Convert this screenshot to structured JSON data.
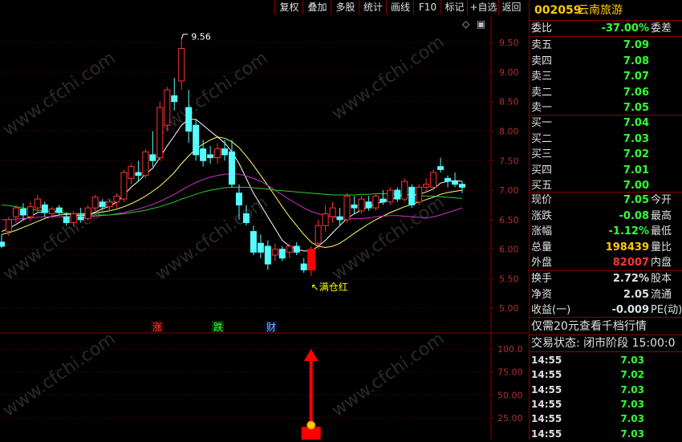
{
  "toolbar": {
    "buttons": [
      "复权",
      "叠加",
      "多股",
      "统计",
      "画线",
      "F10",
      "标记",
      "+自选",
      "返回"
    ]
  },
  "main_chart": {
    "y_axis_labels": [
      "9.50",
      "9.00",
      "8.50",
      "8.00",
      "7.50",
      "7.00",
      "6.50",
      "6.00",
      "5.50",
      "5.00"
    ],
    "high_label": "9.56",
    "signal_label": "满仓红",
    "event_markers": [
      "涨",
      "跌",
      "财"
    ],
    "diamond_icon": "◇",
    "box_icon": "▣"
  },
  "sub_chart": {
    "y_axis_labels": [
      "100.0",
      "75.00",
      "50.00",
      "25.00"
    ]
  },
  "chart_data": {
    "type": "candlestick",
    "ylim": [
      4.65,
      9.95
    ],
    "high_label_value": 9.56,
    "candles": [
      {
        "o": 6.12,
        "h": 6.25,
        "l": 6.02,
        "c": 6.05
      },
      {
        "o": 6.3,
        "h": 6.55,
        "l": 6.22,
        "c": 6.5
      },
      {
        "o": 6.55,
        "h": 6.75,
        "l": 6.45,
        "c": 6.7
      },
      {
        "o": 6.68,
        "h": 6.78,
        "l": 6.5,
        "c": 6.58
      },
      {
        "o": 6.55,
        "h": 6.8,
        "l": 6.48,
        "c": 6.72
      },
      {
        "o": 6.7,
        "h": 6.92,
        "l": 6.62,
        "c": 6.85
      },
      {
        "o": 6.75,
        "h": 6.8,
        "l": 6.55,
        "c": 6.62
      },
      {
        "o": 6.6,
        "h": 6.72,
        "l": 6.52,
        "c": 6.68
      },
      {
        "o": 6.7,
        "h": 6.75,
        "l": 6.58,
        "c": 6.62
      },
      {
        "o": 6.55,
        "h": 6.62,
        "l": 6.4,
        "c": 6.45
      },
      {
        "o": 6.45,
        "h": 6.65,
        "l": 6.38,
        "c": 6.6
      },
      {
        "o": 6.55,
        "h": 6.7,
        "l": 6.45,
        "c": 6.5
      },
      {
        "o": 6.52,
        "h": 6.75,
        "l": 6.48,
        "c": 6.7
      },
      {
        "o": 6.7,
        "h": 6.92,
        "l": 6.65,
        "c": 6.88
      },
      {
        "o": 6.8,
        "h": 6.85,
        "l": 6.68,
        "c": 6.72
      },
      {
        "o": 6.72,
        "h": 6.85,
        "l": 6.65,
        "c": 6.8
      },
      {
        "o": 6.8,
        "h": 6.95,
        "l": 6.7,
        "c": 6.9
      },
      {
        "o": 6.85,
        "h": 7.35,
        "l": 6.8,
        "c": 7.3
      },
      {
        "o": 7.2,
        "h": 7.45,
        "l": 7.1,
        "c": 7.4
      },
      {
        "o": 7.3,
        "h": 7.5,
        "l": 7.15,
        "c": 7.25
      },
      {
        "o": 7.25,
        "h": 7.7,
        "l": 7.2,
        "c": 7.65
      },
      {
        "o": 7.6,
        "h": 8.0,
        "l": 7.4,
        "c": 7.5
      },
      {
        "o": 7.55,
        "h": 8.5,
        "l": 7.5,
        "c": 8.4
      },
      {
        "o": 8.1,
        "h": 8.75,
        "l": 8.0,
        "c": 8.7
      },
      {
        "o": 8.6,
        "h": 8.9,
        "l": 8.35,
        "c": 8.5
      },
      {
        "o": 8.85,
        "h": 9.56,
        "l": 8.7,
        "c": 9.4
      },
      {
        "o": 8.4,
        "h": 8.7,
        "l": 7.8,
        "c": 8.0
      },
      {
        "o": 8.1,
        "h": 8.2,
        "l": 7.5,
        "c": 7.6
      },
      {
        "o": 7.7,
        "h": 7.85,
        "l": 7.4,
        "c": 7.5
      },
      {
        "o": 7.6,
        "h": 7.75,
        "l": 7.45,
        "c": 7.55
      },
      {
        "o": 7.55,
        "h": 7.8,
        "l": 7.45,
        "c": 7.7
      },
      {
        "o": 7.7,
        "h": 7.85,
        "l": 7.5,
        "c": 7.6
      },
      {
        "o": 7.65,
        "h": 7.85,
        "l": 7.05,
        "c": 7.1
      },
      {
        "o": 6.95,
        "h": 7.1,
        "l": 6.5,
        "c": 6.75
      },
      {
        "o": 6.6,
        "h": 6.75,
        "l": 6.4,
        "c": 6.45
      },
      {
        "o": 6.3,
        "h": 6.4,
        "l": 5.9,
        "c": 5.95
      },
      {
        "o": 6.1,
        "h": 6.25,
        "l": 5.85,
        "c": 5.95
      },
      {
        "o": 6.05,
        "h": 6.15,
        "l": 5.65,
        "c": 5.75
      },
      {
        "o": 5.9,
        "h": 6.1,
        "l": 5.8,
        "c": 6.0
      },
      {
        "o": 6.0,
        "h": 6.05,
        "l": 5.8,
        "c": 5.85
      },
      {
        "o": 5.95,
        "h": 6.1,
        "l": 5.85,
        "c": 6.05
      },
      {
        "o": 6.05,
        "h": 6.12,
        "l": 5.9,
        "c": 5.95
      },
      {
        "o": 5.75,
        "h": 5.85,
        "l": 5.6,
        "c": 5.65
      },
      {
        "o": 5.65,
        "h": 6.05,
        "l": 5.55,
        "c": 6.0
      },
      {
        "o": 6.1,
        "h": 6.5,
        "l": 6.0,
        "c": 6.4
      },
      {
        "o": 6.4,
        "h": 6.75,
        "l": 6.3,
        "c": 6.6
      },
      {
        "o": 6.55,
        "h": 6.8,
        "l": 6.45,
        "c": 6.7
      },
      {
        "o": 6.55,
        "h": 6.7,
        "l": 6.4,
        "c": 6.5
      },
      {
        "o": 6.5,
        "h": 6.95,
        "l": 6.45,
        "c": 6.9
      },
      {
        "o": 6.75,
        "h": 6.9,
        "l": 6.6,
        "c": 6.7
      },
      {
        "o": 6.65,
        "h": 6.9,
        "l": 6.6,
        "c": 6.85
      },
      {
        "o": 6.8,
        "h": 6.9,
        "l": 6.65,
        "c": 6.7
      },
      {
        "o": 6.7,
        "h": 6.95,
        "l": 6.65,
        "c": 6.9
      },
      {
        "o": 6.85,
        "h": 7.0,
        "l": 6.75,
        "c": 6.8
      },
      {
        "o": 6.8,
        "h": 7.05,
        "l": 6.75,
        "c": 7.0
      },
      {
        "o": 7.0,
        "h": 7.05,
        "l": 6.8,
        "c": 6.85
      },
      {
        "o": 6.85,
        "h": 7.2,
        "l": 6.8,
        "c": 7.15
      },
      {
        "o": 7.05,
        "h": 7.1,
        "l": 6.7,
        "c": 6.75
      },
      {
        "o": 6.8,
        "h": 7.1,
        "l": 6.75,
        "c": 7.05
      },
      {
        "o": 7.05,
        "h": 7.2,
        "l": 6.95,
        "c": 7.1
      },
      {
        "o": 7.05,
        "h": 7.35,
        "l": 7.0,
        "c": 7.3
      },
      {
        "o": 7.4,
        "h": 7.55,
        "l": 7.3,
        "c": 7.35
      },
      {
        "o": 7.2,
        "h": 7.25,
        "l": 7.05,
        "c": 7.15
      },
      {
        "o": 7.15,
        "h": 7.3,
        "l": 7.05,
        "c": 7.1
      },
      {
        "o": 7.1,
        "h": 7.15,
        "l": 6.95,
        "c": 7.05
      }
    ],
    "signal_candle_index": 43,
    "ma_series": [
      {
        "color": "#ffffff",
        "values": [
          6.3,
          6.35,
          6.42,
          6.5,
          6.55,
          6.62,
          6.63,
          6.65,
          6.63,
          6.6,
          6.58,
          6.57,
          6.58,
          6.63,
          6.68,
          6.73,
          6.8,
          6.92,
          7.05,
          7.15,
          7.27,
          7.37,
          7.55,
          7.75,
          7.92,
          8.1,
          8.2,
          8.2,
          8.1,
          8.0,
          7.9,
          7.8,
          7.65,
          7.45,
          7.2,
          6.95,
          6.75,
          6.55,
          6.35,
          6.15,
          6.05,
          6.0,
          5.97,
          5.97,
          6.05,
          6.15,
          6.28,
          6.4,
          6.52,
          6.6,
          6.66,
          6.72,
          6.77,
          6.8,
          6.85,
          6.88,
          6.93,
          6.92,
          6.93,
          6.97,
          7.02,
          7.12,
          7.15,
          7.16,
          7.15
        ]
      },
      {
        "color": "#ffff66",
        "values": [
          6.25,
          6.28,
          6.32,
          6.37,
          6.42,
          6.47,
          6.52,
          6.56,
          6.58,
          6.59,
          6.6,
          6.6,
          6.6,
          6.61,
          6.63,
          6.65,
          6.68,
          6.72,
          6.77,
          6.83,
          6.9,
          6.98,
          7.07,
          7.18,
          7.3,
          7.45,
          7.58,
          7.7,
          7.78,
          7.85,
          7.9,
          7.88,
          7.82,
          7.72,
          7.58,
          7.42,
          7.25,
          7.08,
          6.9,
          6.72,
          6.55,
          6.4,
          6.25,
          6.12,
          6.05,
          6.03,
          6.05,
          6.1,
          6.18,
          6.27,
          6.35,
          6.43,
          6.5,
          6.56,
          6.62,
          6.67,
          6.72,
          6.76,
          6.8,
          6.84,
          6.88,
          6.93,
          6.96,
          6.98,
          7.0
        ]
      },
      {
        "color": "#cc33cc",
        "values": [
          6.5,
          6.5,
          6.51,
          6.52,
          6.53,
          6.54,
          6.55,
          6.55,
          6.55,
          6.55,
          6.55,
          6.55,
          6.55,
          6.56,
          6.57,
          6.58,
          6.6,
          6.62,
          6.65,
          6.68,
          6.72,
          6.76,
          6.81,
          6.87,
          6.93,
          7.0,
          7.07,
          7.13,
          7.18,
          7.22,
          7.25,
          7.27,
          7.28,
          7.27,
          7.24,
          7.2,
          7.15,
          7.08,
          7.0,
          6.92,
          6.84,
          6.77,
          6.7,
          6.64,
          6.6,
          6.57,
          6.55,
          6.53,
          6.52,
          6.52,
          6.52,
          6.53,
          6.55,
          6.56,
          6.57,
          6.57,
          6.56,
          6.55,
          6.54,
          6.53,
          6.55,
          6.58,
          6.62,
          6.66,
          6.7
        ]
      },
      {
        "color": "#33cc33",
        "values": [
          6.75,
          6.74,
          6.72,
          6.7,
          6.68,
          6.66,
          6.65,
          6.63,
          6.62,
          6.61,
          6.6,
          6.59,
          6.58,
          6.58,
          6.58,
          6.58,
          6.59,
          6.6,
          6.62,
          6.64,
          6.66,
          6.69,
          6.72,
          6.76,
          6.8,
          6.85,
          6.89,
          6.93,
          6.97,
          7.0,
          7.02,
          7.04,
          7.05,
          7.05,
          7.05,
          7.04,
          7.03,
          7.02,
          7.0,
          6.99,
          6.98,
          6.97,
          6.96,
          6.95,
          6.94,
          6.93,
          6.92,
          6.92,
          6.92,
          6.92,
          6.93,
          6.93,
          6.94,
          6.94,
          6.94,
          6.94,
          6.93,
          6.92,
          6.91,
          6.9,
          6.9,
          6.89,
          6.88,
          6.87,
          6.86
        ]
      }
    ]
  },
  "panel": {
    "stock_code": "002059",
    "stock_name": "云南旅游",
    "weibi_label": "委比",
    "weibi_value": "-37.00%",
    "weicha_label": "委差",
    "sells": [
      {
        "label": "卖五",
        "price": "7.09"
      },
      {
        "label": "卖四",
        "price": "7.08"
      },
      {
        "label": "卖三",
        "price": "7.07"
      },
      {
        "label": "卖二",
        "price": "7.06"
      },
      {
        "label": "卖一",
        "price": "7.05"
      }
    ],
    "buys": [
      {
        "label": "买一",
        "price": "7.04"
      },
      {
        "label": "买二",
        "price": "7.03"
      },
      {
        "label": "买三",
        "price": "7.02"
      },
      {
        "label": "买四",
        "price": "7.01"
      },
      {
        "label": "买五",
        "price": "7.00"
      }
    ],
    "stats1": [
      {
        "label": "现价",
        "value": "7.05",
        "label2": "今开"
      },
      {
        "label": "涨跌",
        "value": "-0.08",
        "label2": "最高"
      },
      {
        "label": "涨幅",
        "value": "-1.12%",
        "label2": "最低"
      },
      {
        "label": "总量",
        "value": "198439",
        "label2": "量比"
      },
      {
        "label": "外盘",
        "value": "82007",
        "label2": "内盘"
      }
    ],
    "stats2": [
      {
        "label": "换手",
        "value": "2.72%",
        "label2": "股本"
      },
      {
        "label": "净资",
        "value": "2.05",
        "label2": "流通"
      },
      {
        "label": "收益(一)",
        "value": "-0.009",
        "label2": "PE(动)"
      }
    ],
    "promo": "仅需20元查看千档行情",
    "trade_status": "交易状态: 闭市阶段 15:00:0",
    "ticks": [
      {
        "time": "14:55",
        "price": "7.03"
      },
      {
        "time": "14:55",
        "price": "7.02"
      },
      {
        "time": "14:55",
        "price": "7.03"
      },
      {
        "time": "14:55",
        "price": "7.03"
      },
      {
        "time": "14:55",
        "price": "7.03"
      },
      {
        "time": "14:55",
        "price": "7.03"
      }
    ]
  }
}
